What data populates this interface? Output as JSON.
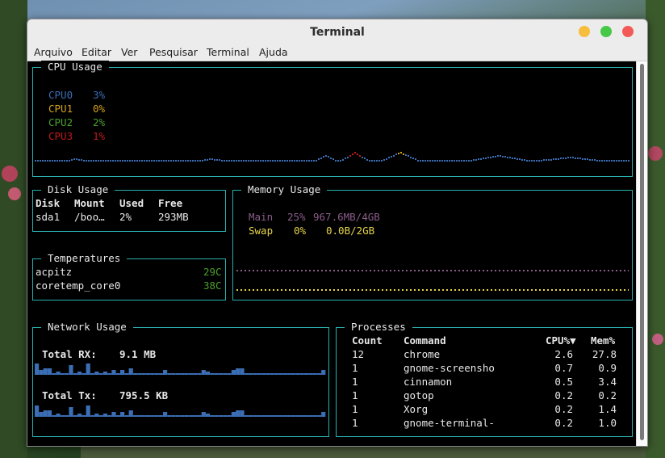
{
  "window": {
    "title": "Terminal"
  },
  "menu": [
    "Arquivo",
    "Editar",
    "Ver",
    "Pesquisar",
    "Terminal",
    "Ajuda"
  ],
  "colors": {
    "border": "#2bb0b0",
    "cpu0": "#3b6eb5",
    "cpu1": "#d4a017",
    "cpu2": "#4aa02c",
    "cpu3": "#c0191a",
    "mem_main": "#8a5c8a",
    "mem_swap": "#e6d44a",
    "temp": "#4aa02c",
    "net_bar": "#3b6eb5"
  },
  "cpu": {
    "title": "CPU Usage",
    "cores": [
      {
        "name": "CPU0",
        "value": "3%"
      },
      {
        "name": "CPU1",
        "value": "0%"
      },
      {
        "name": "CPU2",
        "value": "2%"
      },
      {
        "name": "CPU3",
        "value": "1%"
      }
    ]
  },
  "disk": {
    "title": "Disk Usage",
    "headers": [
      "Disk",
      "Mount",
      "Used",
      "Free"
    ],
    "row": [
      "sda1",
      "/boo…",
      "2%",
      "293MB"
    ]
  },
  "temperatures": {
    "title": "Temperatures",
    "items": [
      {
        "name": "acpitz",
        "value": "29C"
      },
      {
        "name": "coretemp_core0",
        "value": "38C"
      }
    ]
  },
  "memory": {
    "title": "Memory Usage",
    "main": {
      "label": "Main",
      "pct": "25%",
      "val": "967.6MB/4GB"
    },
    "swap": {
      "label": "Swap",
      "pct": "0%",
      "val": "0.0B/2GB"
    }
  },
  "network": {
    "title": "Network Usage",
    "rx_label": "Total RX:",
    "rx_value": "9.1 MB",
    "tx_label": "Total Tx:",
    "tx_value": "795.5 KB"
  },
  "processes": {
    "title": "Processes",
    "headers": [
      "Count",
      "Command",
      "CPU%▼",
      "Mem%"
    ],
    "rows": [
      [
        "12",
        "chrome",
        "2.6",
        "27.8"
      ],
      [
        "1",
        "gnome-screensho",
        "0.7",
        "0.9"
      ],
      [
        "1",
        "cinnamon",
        "0.5",
        "3.4"
      ],
      [
        "1",
        "gotop",
        "0.2",
        "0.2"
      ],
      [
        "1",
        "Xorg",
        "0.2",
        "1.4"
      ],
      [
        "1",
        "gnome-terminal-",
        "0.2",
        "1.0"
      ]
    ]
  }
}
